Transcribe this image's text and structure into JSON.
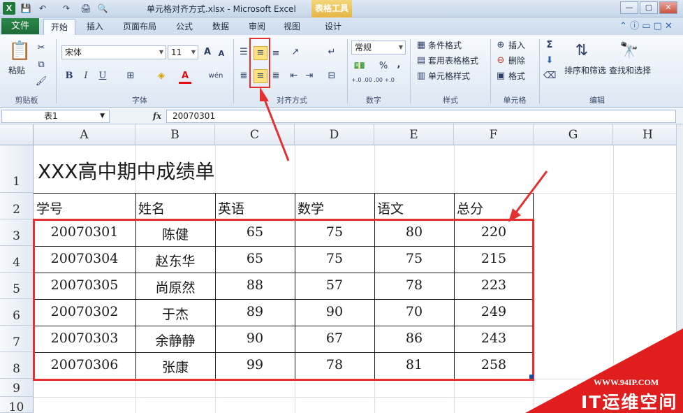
{
  "titlebar": {
    "title": "单元格对齐方式.xlsx - Microsoft Excel",
    "tool_tab_title": "表格工具",
    "logo": "X",
    "qat": [
      "💾",
      "↶",
      "↷",
      "🖨",
      "🔍"
    ],
    "window_controls": [
      "—",
      "▢",
      "✕"
    ]
  },
  "tabs": {
    "file": "文件",
    "items": [
      "开始",
      "插入",
      "页面布局",
      "公式",
      "数据",
      "审阅",
      "视图",
      "设计"
    ],
    "active": "开始"
  },
  "ribbon": {
    "clipboard": {
      "paste": "粘贴",
      "label": "剪贴板"
    },
    "font": {
      "name": "宋体",
      "size": "11",
      "label": "字体",
      "bold": "B",
      "italic": "I",
      "underline": "U",
      "grow": "A",
      "shrink": "A",
      "font_color": "A",
      "wen": "wén"
    },
    "alignment": {
      "label": "对齐方式"
    },
    "number": {
      "format": "常规",
      "percent": "%",
      "comma": ",",
      "label": "数字",
      "inc": "+.0 .00",
      "dec": ".00 +.0"
    },
    "styles": {
      "conditional": "条件格式",
      "table": "套用表格格式",
      "cell": "单元格样式",
      "label": "样式"
    },
    "cells": {
      "insert": "插入",
      "delete": "删除",
      "format": "格式",
      "label": "单元格"
    },
    "editing": {
      "sum": "Σ",
      "sort": "排序和筛选",
      "find": "查找和选择",
      "label": "编辑"
    }
  },
  "formula_bar": {
    "name_box": "表1",
    "fx": "fx",
    "value": "20070301"
  },
  "sheet": {
    "columns": [
      "A",
      "B",
      "C",
      "D",
      "E",
      "F",
      "G",
      "H"
    ],
    "rows": [
      "1",
      "2",
      "3",
      "4",
      "5",
      "6",
      "7",
      "8",
      "9",
      "10"
    ],
    "title": "XXX高中期中成绩单",
    "headers": [
      "学号",
      "姓名",
      "英语",
      "数学",
      "语文",
      "总分"
    ],
    "data": [
      [
        "20070301",
        "陈健",
        "65",
        "75",
        "80",
        "220"
      ],
      [
        "20070304",
        "赵东华",
        "65",
        "75",
        "75",
        "215"
      ],
      [
        "20070305",
        "尚原然",
        "88",
        "57",
        "78",
        "223"
      ],
      [
        "20070302",
        "于杰",
        "89",
        "90",
        "70",
        "249"
      ],
      [
        "20070303",
        "余静静",
        "90",
        "67",
        "86",
        "243"
      ],
      [
        "20070306",
        "张康",
        "99",
        "78",
        "81",
        "258"
      ]
    ]
  },
  "watermark": {
    "url": "WWW.94IP.COM",
    "text": "IT运维空间"
  },
  "colors": {
    "accent_red": "#e53030",
    "file_tab": "#1d6a36",
    "highlight": "#ffe27d"
  }
}
